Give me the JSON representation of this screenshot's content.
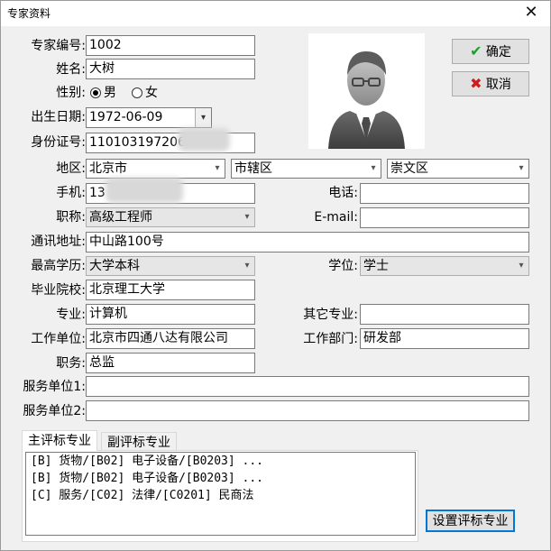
{
  "window": {
    "title": "专家资料",
    "close_glyph": "✕"
  },
  "buttons": {
    "ok": "确定",
    "cancel": "取消",
    "set_specialty": "设置评标专业"
  },
  "labels": {
    "expert_no": "专家编号:",
    "name": "姓名:",
    "gender": "性别:",
    "birth": "出生日期:",
    "id_no": "身份证号:",
    "region": "地区:",
    "mobile": "手机:",
    "phone": "电话:",
    "title": "职称:",
    "email": "E-mail:",
    "address": "通讯地址:",
    "education": "最高学历:",
    "degree": "学位:",
    "school": "毕业院校:",
    "major": "专业:",
    "other_major": "其它专业:",
    "work_unit": "工作单位:",
    "department": "工作部门:",
    "position": "职务:",
    "service_unit1": "服务单位1:",
    "service_unit2": "服务单位2:"
  },
  "values": {
    "expert_no": "1002",
    "name": "大树",
    "gender_male": "男",
    "gender_female": "女",
    "birth": "1972-06-09",
    "id_no": "1101031972060",
    "region_city": "北京市",
    "region_district": "市辖区",
    "region_area": "崇文区",
    "mobile": "13",
    "phone": "",
    "title": "高级工程师",
    "email": "",
    "address": "中山路100号",
    "education": "大学本科",
    "degree": "学士",
    "school": "北京理工大学",
    "major": "计算机",
    "other_major": "",
    "work_unit": "北京市四通八达有限公司",
    "department": "研发部",
    "position": "总监",
    "service_unit1": "",
    "service_unit2": ""
  },
  "tabs": {
    "primary": "主评标专业",
    "secondary": "副评标专业"
  },
  "specialties": [
    "[B] 货物/[B02] 电子设备/[B0203] ...",
    "[B] 货物/[B02] 电子设备/[B0203] ...",
    "[C] 服务/[C02] 法律/[C0201] 民商法"
  ],
  "icons": {
    "ok": "check-icon",
    "cancel": "x-icon",
    "photo": "avatar-placeholder",
    "ok_color": "#1f9e2f",
    "cancel_color": "#d11a1a"
  }
}
